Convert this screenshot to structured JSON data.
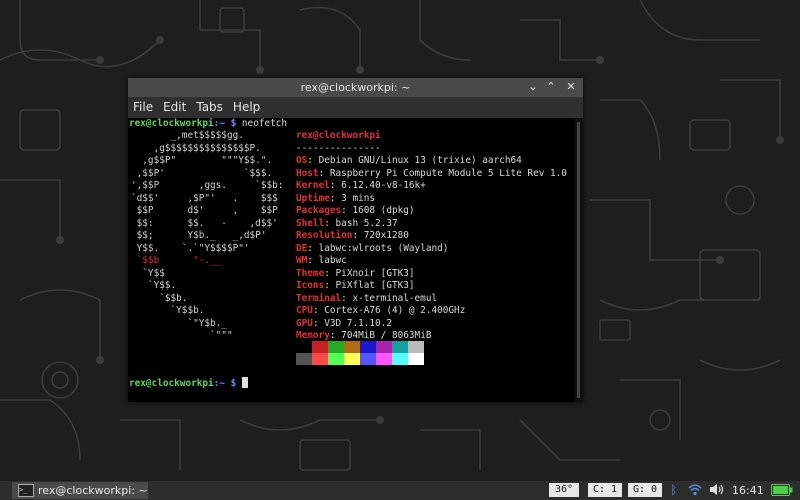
{
  "window": {
    "title": "rex@clockworkpi: ~",
    "buttons": {
      "minimize": "⌄",
      "maximize": "⌃",
      "close": "✕"
    },
    "menu": [
      "File",
      "Edit",
      "Tabs",
      "Help"
    ]
  },
  "terminal": {
    "prompt_user": "rex@clockworkpi",
    "prompt_path": ":~ $ ",
    "command": "neofetch",
    "logo_lines": [
      "       _,met$$$$$gg.",
      "    ,g$$$$$$$$$$$$$$$P.",
      "  ,g$$P\"        \"\"\"Y$$.\".",
      " ,$$P'              `$$$.",
      "',$$P       ,ggs.     `$$b:",
      "`d$$'     ,$P\"'   .    $$$",
      " $$P      d$'     ,    $$P",
      " $$:      $$.   -    ,d$$'",
      " $$;      Y$b._   _,d$P'",
      " Y$$.    `.`\"Y$$$$P\"'",
      " `$$b      \"-.__",
      "  `Y$$",
      "   `Y$$.",
      "     `$$b.",
      "       `Y$$b.",
      "          `\"Y$b._",
      "              `\"\"\""
    ],
    "header_user": "rex@clockworkpi",
    "separator": "---------------",
    "info": [
      {
        "key": "OS",
        "value": "Debian GNU/Linux 13 (trixie) aarch64"
      },
      {
        "key": "Host",
        "value": "Raspberry Pi Compute Module 5 Lite Rev 1.0"
      },
      {
        "key": "Kernel",
        "value": "6.12.40-v8-16k+"
      },
      {
        "key": "Uptime",
        "value": "3 mins"
      },
      {
        "key": "Packages",
        "value": "1608 (dpkg)"
      },
      {
        "key": "Shell",
        "value": "bash 5.2.37"
      },
      {
        "key": "Resolution",
        "value": "720x1280"
      },
      {
        "key": "DE",
        "value": "labwc:wlroots (Wayland)"
      },
      {
        "key": "WM",
        "value": "labwc"
      },
      {
        "key": "Theme",
        "value": "PiXnoir [GTK3]"
      },
      {
        "key": "Icons",
        "value": "PiXflat [GTK3]"
      },
      {
        "key": "Terminal",
        "value": "x-terminal-emul"
      },
      {
        "key": "CPU",
        "value": "Cortex-A76 (4) @ 2.400GHz"
      },
      {
        "key": "GPU",
        "value": "V3D 7.1.10.2"
      },
      {
        "key": "Memory",
        "value": "704MiB / 8063MiB"
      }
    ],
    "palette_top": [
      "#000000",
      "#cc1f1f",
      "#22aa22",
      "#b06a10",
      "#1a1acc",
      "#aa22aa",
      "#11a0a0",
      "#bbbbbb"
    ],
    "palette_bottom": [
      "#555555",
      "#ff4a4a",
      "#55ff55",
      "#ffff55",
      "#5555ff",
      "#ff55ff",
      "#55ffff",
      "#ffffff"
    ],
    "final_prompt_user": "rex@clockworkpi",
    "final_prompt_path": ":~ $ "
  },
  "taskbar": {
    "task_label": "rex@clockworkpi: ~",
    "temperature": "36°",
    "cpu_label": "C:",
    "cpu_value": "1",
    "gpu_label": "G:",
    "gpu_value": "0",
    "clock": "16:41",
    "icons": [
      "terminal-icon",
      "bluetooth-icon",
      "wifi-icon",
      "volume-icon",
      "battery-icon"
    ]
  },
  "colors": {
    "prompt_green": "#5ed65e",
    "prompt_blue": "#6b8cff",
    "key_red": "#e0303a",
    "tray_blue": "#5a8ee8"
  }
}
